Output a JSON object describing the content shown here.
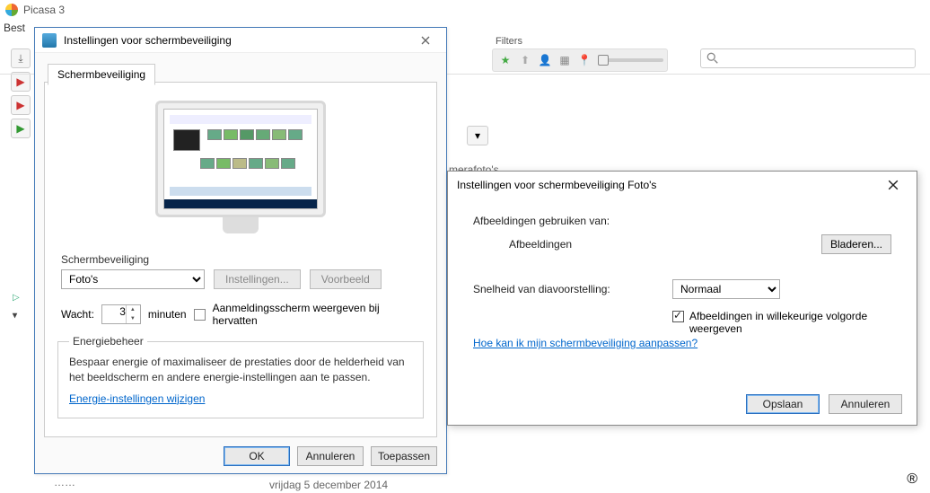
{
  "app": {
    "title": "Picasa 3"
  },
  "menu": {
    "first_item": "Best"
  },
  "filters": {
    "label": "Filters"
  },
  "main": {
    "folder_hint": "merafoto's",
    "list_item": "……",
    "date_line": "vrijdag 5 december 2014"
  },
  "dlg1": {
    "title": "Instellingen voor schermbeveiliging",
    "tab": "Schermbeveiliging",
    "section": "Schermbeveiliging",
    "dropdown_value": "Foto's",
    "btn_settings": "Instellingen...",
    "btn_preview": "Voorbeeld",
    "wait_label": "Wacht:",
    "wait_value": "3",
    "wait_unit": "minuten",
    "resume_chk": "Aanmeldingsscherm weergeven bij hervatten",
    "energy_legend": "Energiebeheer",
    "energy_text": "Bespaar energie of maximaliseer de prestaties door de helderheid van het beeldscherm en andere energie-instellingen aan te passen.",
    "energy_link": "Energie-instellingen wijzigen",
    "ok": "OK",
    "cancel": "Annuleren",
    "apply": "Toepassen"
  },
  "dlg2": {
    "title": "Instellingen voor schermbeveiliging Foto's",
    "use_from": "Afbeeldingen gebruiken van:",
    "use_value": "Afbeeldingen",
    "browse": "Bladeren...",
    "speed_label": "Snelheid van diavoorstelling:",
    "speed_value": "Normaal",
    "shuffle": "Afbeeldingen in willekeurige volgorde weergeven",
    "help": "Hoe kan ik mijn schermbeveiliging aanpassen?",
    "save": "Opslaan",
    "cancel": "Annuleren"
  }
}
